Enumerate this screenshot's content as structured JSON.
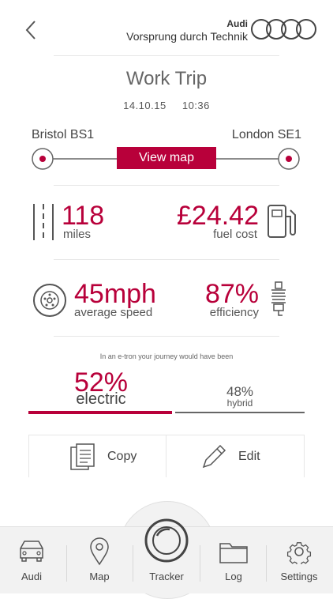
{
  "header": {
    "back_icon": "chevron-left-icon",
    "brand_name": "Audi",
    "brand_tagline": "Vorsprung durch Technik",
    "logo_icon": "four-rings-icon"
  },
  "trip": {
    "title": "Work Trip",
    "date": "14.10.15",
    "time": "10:36"
  },
  "route": {
    "from": "Bristol BS1",
    "to": "London SE1",
    "view_map_label": "View map"
  },
  "stats": {
    "distance_value": "118",
    "distance_unit": "miles",
    "fuel_value": "£24.42",
    "fuel_label": "fuel cost",
    "speed_value": "45mph",
    "speed_label": "average speed",
    "efficiency_value": "87%",
    "efficiency_label": "efficiency"
  },
  "etron": {
    "note": "In an e-tron your journey would have been",
    "electric_value": "52%",
    "electric_label": "electric",
    "hybrid_value": "48%",
    "hybrid_label": "hybrid",
    "electric_fraction": 0.52
  },
  "actions": {
    "copy_label": "Copy",
    "edit_label": "Edit"
  },
  "tabs": [
    {
      "label": "Audi",
      "icon": "car-icon"
    },
    {
      "label": "Map",
      "icon": "map-pin-icon"
    },
    {
      "label": "Tracker",
      "icon": "tracker-icon"
    },
    {
      "label": "Log",
      "icon": "folder-icon"
    },
    {
      "label": "Settings",
      "icon": "gear-icon"
    }
  ],
  "colors": {
    "accent": "#b8003a",
    "text": "#555555",
    "tabbar_bg": "#f2f2f2"
  }
}
